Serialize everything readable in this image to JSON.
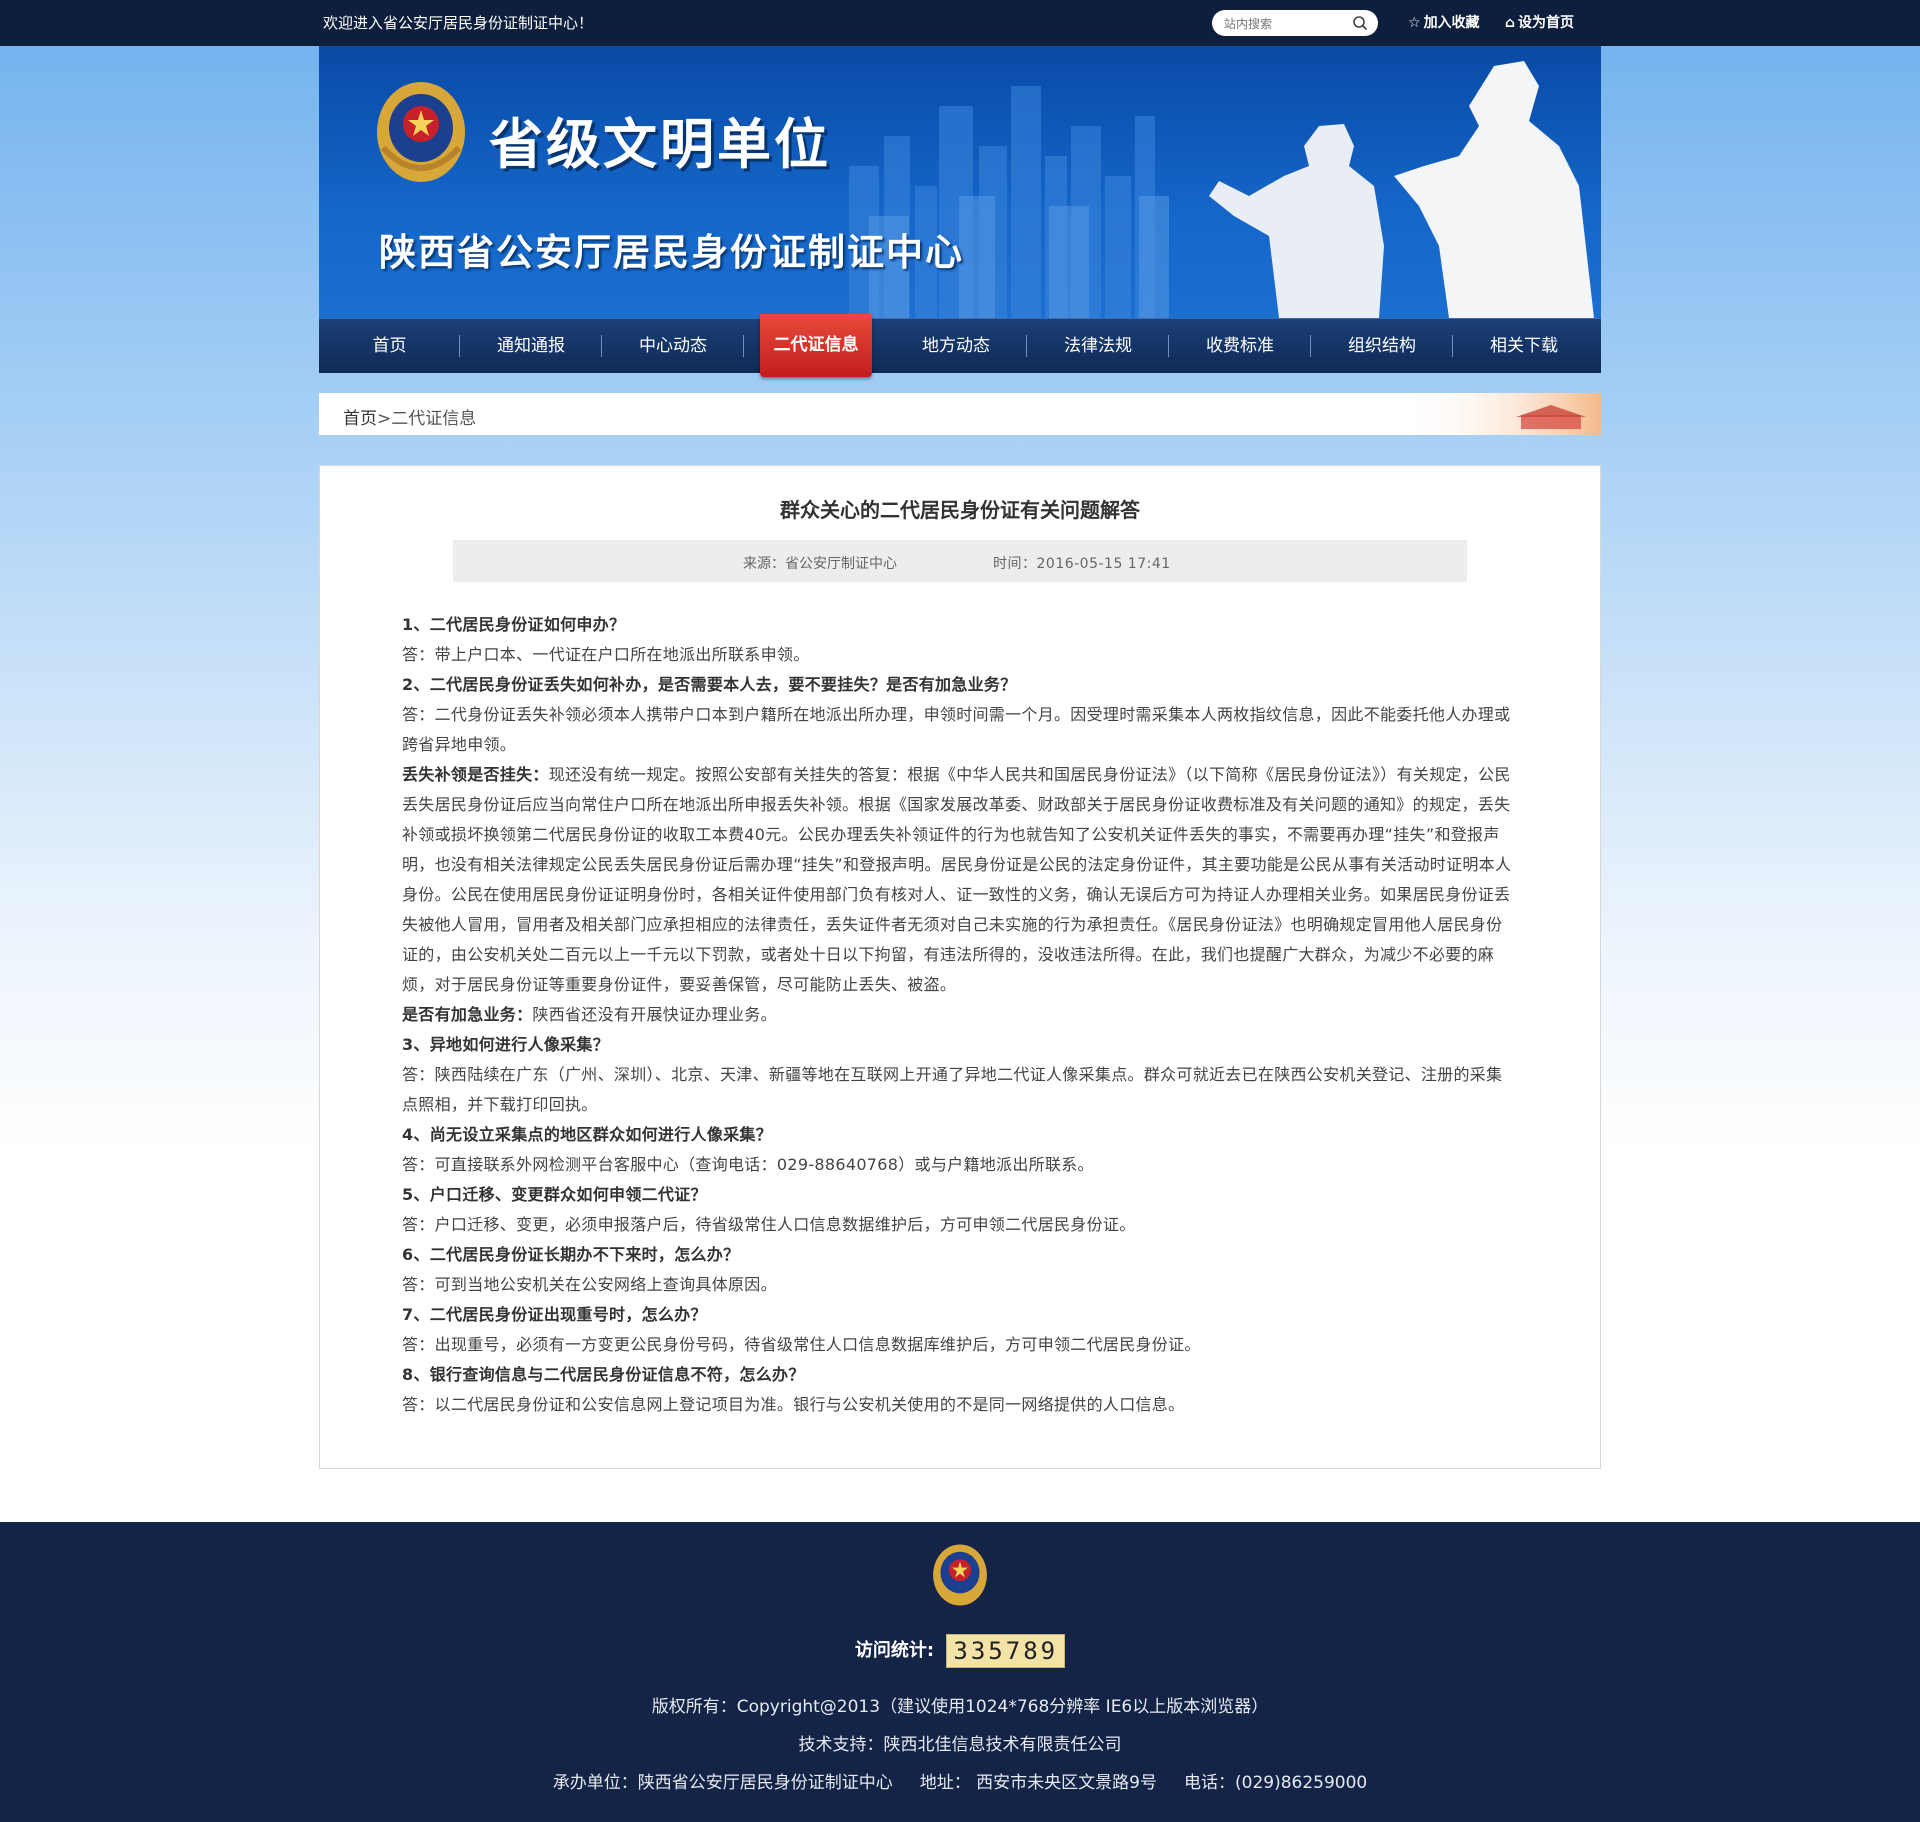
{
  "topbar": {
    "welcome": "欢迎进入省公安厅居民身份证制证中心！",
    "search_placeholder": "站内搜索",
    "favorite": "加入收藏",
    "homepage": "设为首页"
  },
  "banner": {
    "motto": "省级文明单位",
    "org_title": "陕西省公安厅居民身份证制证中心"
  },
  "nav": [
    "首页",
    "通知通报",
    "中心动态",
    "二代证信息",
    "地方动态",
    "法律法规",
    "收费标准",
    "组织结构",
    "相关下载"
  ],
  "breadcrumb": {
    "home": "首页",
    "separator": ">",
    "current": "二代证信息"
  },
  "article": {
    "title": "群众关心的二代居民身份证有关问题解答",
    "source": "来源：省公安厅制证中心",
    "time": "时间：2016-05-15 17:41",
    "paragraphs": [
      {
        "type": "q",
        "text": "1、二代居民身份证如何申办？"
      },
      {
        "type": "a",
        "text": "答：带上户口本、一代证在户口所在地派出所联系申领。"
      },
      {
        "type": "q",
        "text": "2、二代居民身份证丢失如何补办，是否需要本人去，要不要挂失？是否有加急业务？"
      },
      {
        "type": "a",
        "text": "答：二代身份证丢失补领必须本人携带户口本到户籍所在地派出所办理，申领时间需一个月。因受理时需采集本人两枚指纹信息，因此不能委托他人办理或跨省异地申领。"
      },
      {
        "type": "m",
        "lead": "丢失补领是否挂失：",
        "text": "现还没有统一规定。按照公安部有关挂失的答复：根据《中华人民共和国居民身份证法》（以下简称《居民身份证法》）有关规定，公民丢失居民身份证后应当向常住户口所在地派出所申报丢失补领。根据《国家发展改革委、财政部关于居民身份证收费标准及有关问题的通知》的规定，丢失补领或损坏换领第二代居民身份证的收取工本费40元。公民办理丢失补领证件的行为也就告知了公安机关证件丢失的事实，不需要再办理“挂失”和登报声明，也没有相关法律规定公民丢失居民身份证后需办理“挂失”和登报声明。居民身份证是公民的法定身份证件，其主要功能是公民从事有关活动时证明本人身份。公民在使用居民身份证证明身份时，各相关证件使用部门负有核对人、证一致性的义务，确认无误后方可为持证人办理相关业务。如果居民身份证丢失被他人冒用，冒用者及相关部门应承担相应的法律责任，丢失证件者无须对自己未实施的行为承担责任。《居民身份证法》也明确规定冒用他人居民身份证的，由公安机关处二百元以上一千元以下罚款，或者处十日以下拘留，有违法所得的，没收违法所得。在此，我们也提醒广大群众，为减少不必要的麻烦，对于居民身份证等重要身份证件，要妥善保管，尽可能防止丢失、被盗。"
      },
      {
        "type": "m",
        "lead": "是否有加急业务：",
        "text": "陕西省还没有开展快证办理业务。"
      },
      {
        "type": "q",
        "text": "3、异地如何进行人像采集？"
      },
      {
        "type": "a",
        "text": "答：陕西陆续在广东（广州、深圳）、北京、天津、新疆等地在互联网上开通了异地二代证人像采集点。群众可就近去已在陕西公安机关登记、注册的采集点照相，并下载打印回执。"
      },
      {
        "type": "q",
        "text": "4、尚无设立采集点的地区群众如何进行人像采集？"
      },
      {
        "type": "a",
        "text": "答：可直接联系外网检测平台客服中心（查询电话：029-88640768）或与户籍地派出所联系。"
      },
      {
        "type": "q",
        "text": "5、户口迁移、变更群众如何申领二代证？"
      },
      {
        "type": "a",
        "text": "答：户口迁移、变更，必须申报落户后，待省级常住人口信息数据维护后，方可申领二代居民身份证。"
      },
      {
        "type": "q",
        "text": "6、二代居民身份证长期办不下来时，怎么办？"
      },
      {
        "type": "a",
        "text": "答：可到当地公安机关在公安网络上查询具体原因。"
      },
      {
        "type": "q",
        "text": "7、二代居民身份证出现重号时，怎么办？"
      },
      {
        "type": "a",
        "text": "答：出现重号，必须有一方变更公民身份号码，待省级常住人口信息数据库维护后，方可申领二代居民身份证。"
      },
      {
        "type": "q",
        "text": "8、银行查询信息与二代居民身份证信息不符，怎么办？"
      },
      {
        "type": "a",
        "text": "答：以二代居民身份证和公安信息网上登记项目为准。银行与公安机关使用的不是同一网络提供的人口信息。"
      }
    ]
  },
  "footer": {
    "visits_label": "访问统计:",
    "visits": "335789",
    "copyright": "版权所有：Copyright@2013（建议使用1024*768分辨率  IE6以上版本浏览器）",
    "support": "技术支持：陕西北佳信息技术有限责任公司",
    "contact": "承办单位：陕西省公安厅居民身份证制证中心     地址： 西安市未央区文景路9号     电话：(029)86259000"
  },
  "colors": {
    "topbar": "#0d1f3c",
    "nav": "#15356a",
    "nav_active": "#d42c24",
    "footer": "#142447"
  },
  "icons": [
    "search-icon",
    "star-icon",
    "home-icon",
    "police-emblem-icon"
  ]
}
